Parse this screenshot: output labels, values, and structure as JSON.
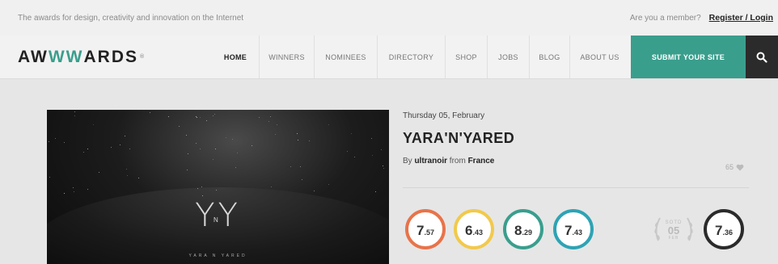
{
  "topbar": {
    "tagline": "The awards for design, creativity and innovation on the Internet",
    "member_prompt": "Are you a member?",
    "register_link": "Register / Login"
  },
  "nav": {
    "logo": {
      "a": "AW",
      "ww": "WW",
      "rest": "ARDS",
      "mark": "®"
    },
    "items": [
      "HOME",
      "WINNERS",
      "NOMINEES",
      "DIRECTORY",
      "SHOP",
      "JOBS",
      "BLOG",
      "ABOUT US"
    ],
    "submit_label": "SUBMIT YOUR SITE",
    "search_icon": "search-icon"
  },
  "site": {
    "date": "Thursday 05, February",
    "title": "YARA'N'YARED",
    "by_label": "By",
    "author": "ultranoir",
    "from_label": "from",
    "country": "France",
    "likes": "65",
    "hero_logo": "YY",
    "hero_logo_n": "N",
    "hero_caption": "YARA N YARED"
  },
  "scores": [
    {
      "big": "7",
      "small": ".57",
      "color": "#e8734a"
    },
    {
      "big": "6",
      "small": ".43",
      "color": "#f2c94c"
    },
    {
      "big": "8",
      "small": ".29",
      "color": "#3a9e8d"
    },
    {
      "big": "7",
      "small": ".43",
      "color": "#2ea3b4"
    }
  ],
  "sotd": {
    "label": "SOTD",
    "day": "05",
    "month": "FEB"
  },
  "overall": {
    "big": "7",
    "small": ".36",
    "color": "#2b2b2b"
  }
}
